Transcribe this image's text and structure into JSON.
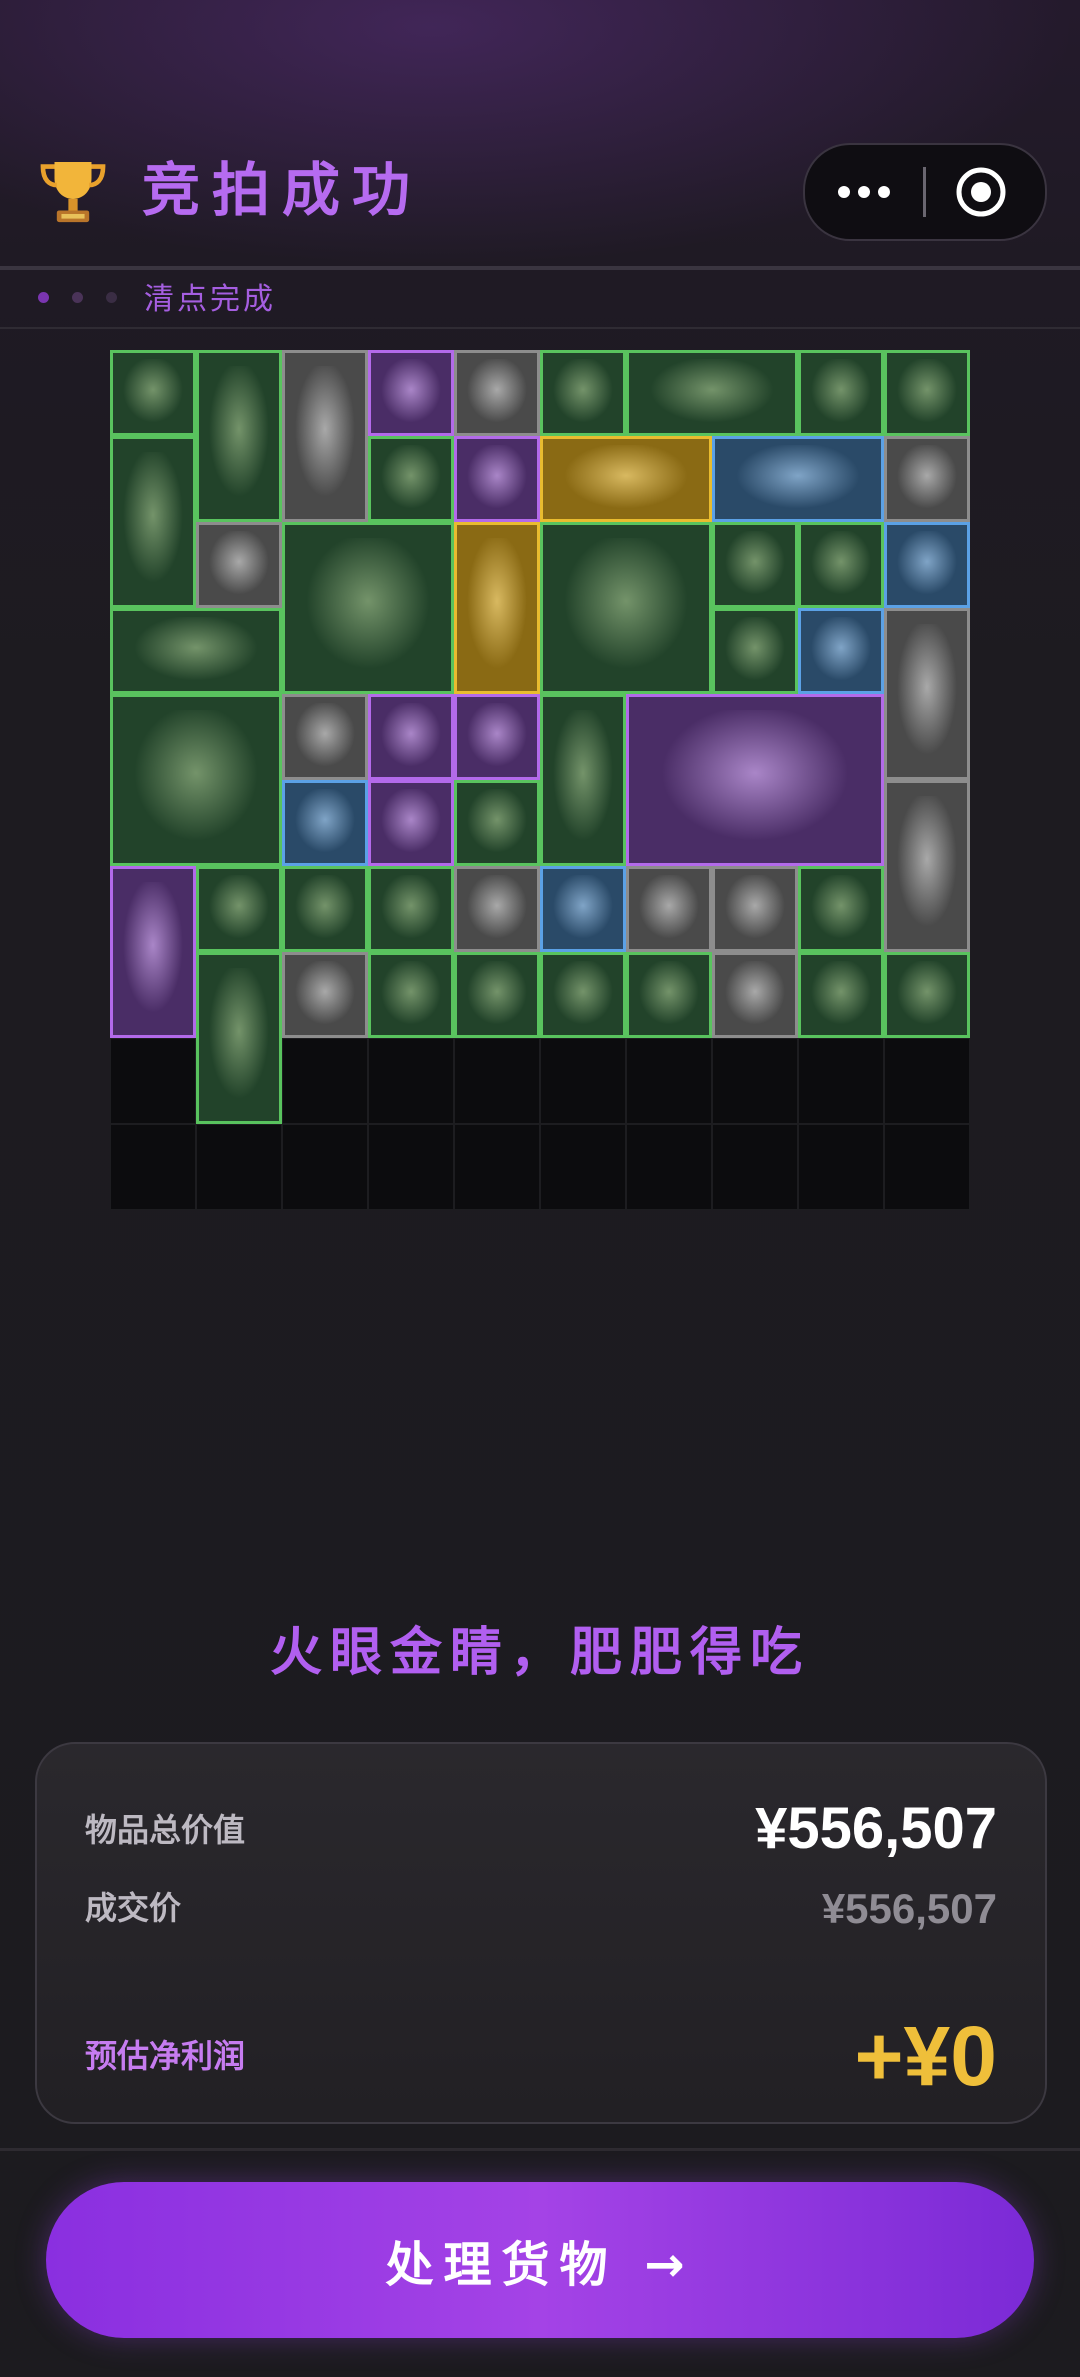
{
  "header": {
    "title": "竞拍成功",
    "trophy_icon": "trophy-icon",
    "capsule": {
      "more_icon": "more-dots-icon",
      "close_icon": "target-close-icon"
    }
  },
  "status": {
    "text": "清点完成",
    "dot_colors": [
      "#7a35b0",
      "#4a3358",
      "#3a2d44"
    ]
  },
  "inventory": {
    "columns": 10,
    "rows": 10,
    "rarity_colors": {
      "green": "#59c35e",
      "purple": "#b36aea",
      "blue": "#5ba1e6",
      "gold": "#e9bc2f",
      "gray": "#8d8d8d"
    },
    "items": [
      {
        "name": "tweezers",
        "rarity": "green",
        "c": 0,
        "r": 0,
        "w": 1,
        "h": 1
      },
      {
        "name": "leather-journal",
        "rarity": "green",
        "c": 1,
        "r": 0,
        "w": 1,
        "h": 2
      },
      {
        "name": "toothpaste",
        "rarity": "gray",
        "c": 2,
        "r": 0,
        "w": 1,
        "h": 2
      },
      {
        "name": "ring",
        "rarity": "purple",
        "c": 3,
        "r": 0,
        "w": 1,
        "h": 1
      },
      {
        "name": "yogurt-cup",
        "rarity": "gray",
        "c": 4,
        "r": 0,
        "w": 1,
        "h": 1
      },
      {
        "name": "pliers",
        "rarity": "green",
        "c": 5,
        "r": 0,
        "w": 1,
        "h": 1
      },
      {
        "name": "old-map",
        "rarity": "green",
        "c": 6,
        "r": 0,
        "w": 2,
        "h": 1
      },
      {
        "name": "power-strip",
        "rarity": "green",
        "c": 8,
        "r": 0,
        "w": 1,
        "h": 1
      },
      {
        "name": "coin",
        "rarity": "green",
        "c": 9,
        "r": 0,
        "w": 1,
        "h": 1
      },
      {
        "name": "spray-can",
        "rarity": "green",
        "c": 0,
        "r": 1,
        "w": 1,
        "h": 2
      },
      {
        "name": "screwdriver-pen",
        "rarity": "green",
        "c": 3,
        "r": 1,
        "w": 1,
        "h": 1
      },
      {
        "name": "knife",
        "rarity": "purple",
        "c": 4,
        "r": 1,
        "w": 1,
        "h": 1
      },
      {
        "name": "gold-tiara",
        "rarity": "gold",
        "c": 5,
        "r": 1,
        "w": 2,
        "h": 1
      },
      {
        "name": "smoking-pipe",
        "rarity": "blue",
        "c": 7,
        "r": 1,
        "w": 2,
        "h": 1
      },
      {
        "name": "gloves",
        "rarity": "gray",
        "c": 9,
        "r": 1,
        "w": 1,
        "h": 1
      },
      {
        "name": "playing-card",
        "rarity": "gray",
        "c": 1,
        "r": 2,
        "w": 1,
        "h": 1
      },
      {
        "name": "magazine",
        "rarity": "green",
        "c": 2,
        "r": 2,
        "w": 2,
        "h": 2
      },
      {
        "name": "test-tube-kit",
        "rarity": "gold",
        "c": 4,
        "r": 2,
        "w": 1,
        "h": 2
      },
      {
        "name": "angle-grinder",
        "rarity": "green",
        "c": 5,
        "r": 2,
        "w": 2,
        "h": 2
      },
      {
        "name": "tweezers",
        "rarity": "green",
        "c": 7,
        "r": 2,
        "w": 1,
        "h": 1
      },
      {
        "name": "wrench",
        "rarity": "green",
        "c": 8,
        "r": 2,
        "w": 1,
        "h": 1
      },
      {
        "name": "mp3-player",
        "rarity": "blue",
        "c": 9,
        "r": 2,
        "w": 1,
        "h": 1
      },
      {
        "name": "glass-tube",
        "rarity": "green",
        "c": 0,
        "r": 3,
        "w": 2,
        "h": 1
      },
      {
        "name": "screwdriver",
        "rarity": "green",
        "c": 7,
        "r": 3,
        "w": 1,
        "h": 1
      },
      {
        "name": "cd-disc",
        "rarity": "blue",
        "c": 8,
        "r": 3,
        "w": 1,
        "h": 1
      },
      {
        "name": "toothpaste",
        "rarity": "gray",
        "c": 9,
        "r": 3,
        "w": 1,
        "h": 2
      },
      {
        "name": "newspaper",
        "rarity": "green",
        "c": 0,
        "r": 4,
        "w": 2,
        "h": 2
      },
      {
        "name": "tape-measure",
        "rarity": "gray",
        "c": 2,
        "r": 4,
        "w": 1,
        "h": 1
      },
      {
        "name": "circuit-board",
        "rarity": "purple",
        "c": 3,
        "r": 4,
        "w": 1,
        "h": 1
      },
      {
        "name": "usb-stick",
        "rarity": "purple",
        "c": 4,
        "r": 4,
        "w": 1,
        "h": 1
      },
      {
        "name": "statue",
        "rarity": "green",
        "c": 5,
        "r": 4,
        "w": 1,
        "h": 2
      },
      {
        "name": "car-battery",
        "rarity": "purple",
        "c": 6,
        "r": 4,
        "w": 3,
        "h": 2
      },
      {
        "name": "power-bank",
        "rarity": "blue",
        "c": 2,
        "r": 5,
        "w": 1,
        "h": 1
      },
      {
        "name": "tea-cup",
        "rarity": "purple",
        "c": 3,
        "r": 5,
        "w": 1,
        "h": 1
      },
      {
        "name": "glue-bottle",
        "rarity": "green",
        "c": 4,
        "r": 5,
        "w": 1,
        "h": 1
      },
      {
        "name": "medicine-bottle",
        "rarity": "gray",
        "c": 9,
        "r": 5,
        "w": 1,
        "h": 2
      },
      {
        "name": "gold-ewer",
        "rarity": "purple",
        "c": 0,
        "r": 6,
        "w": 1,
        "h": 2
      },
      {
        "name": "battery",
        "rarity": "green",
        "c": 1,
        "r": 6,
        "w": 1,
        "h": 1
      },
      {
        "name": "apple",
        "rarity": "green",
        "c": 2,
        "r": 6,
        "w": 1,
        "h": 1
      },
      {
        "name": "card-pack",
        "rarity": "green",
        "c": 3,
        "r": 6,
        "w": 1,
        "h": 1
      },
      {
        "name": "duct-tape",
        "rarity": "gray",
        "c": 4,
        "r": 6,
        "w": 1,
        "h": 1
      },
      {
        "name": "capacitor",
        "rarity": "blue",
        "c": 5,
        "r": 6,
        "w": 1,
        "h": 1
      },
      {
        "name": "scissors",
        "rarity": "gray",
        "c": 6,
        "r": 6,
        "w": 1,
        "h": 1
      },
      {
        "name": "scissors",
        "rarity": "gray",
        "c": 7,
        "r": 6,
        "w": 1,
        "h": 1
      },
      {
        "name": "tweezers",
        "rarity": "green",
        "c": 8,
        "r": 6,
        "w": 1,
        "h": 1
      },
      {
        "name": "pressure-gauge",
        "rarity": "green",
        "c": 1,
        "r": 7,
        "w": 1,
        "h": 2
      },
      {
        "name": "papers",
        "rarity": "gray",
        "c": 2,
        "r": 7,
        "w": 1,
        "h": 1
      },
      {
        "name": "glue-bottle",
        "rarity": "green",
        "c": 3,
        "r": 7,
        "w": 1,
        "h": 1
      },
      {
        "name": "lighter",
        "rarity": "green",
        "c": 4,
        "r": 7,
        "w": 1,
        "h": 1
      },
      {
        "name": "hard-drive",
        "rarity": "green",
        "c": 5,
        "r": 7,
        "w": 1,
        "h": 1
      },
      {
        "name": "snack-bar",
        "rarity": "green",
        "c": 6,
        "r": 7,
        "w": 1,
        "h": 1
      },
      {
        "name": "pill-case",
        "rarity": "gray",
        "c": 7,
        "r": 7,
        "w": 1,
        "h": 1
      },
      {
        "name": "mouse-pad",
        "rarity": "green",
        "c": 8,
        "r": 7,
        "w": 1,
        "h": 1
      },
      {
        "name": "mouse-pad",
        "rarity": "green",
        "c": 9,
        "r": 7,
        "w": 1,
        "h": 1
      }
    ]
  },
  "slogan": "火眼金睛，肥肥得吃",
  "summary": {
    "total_label": "物品总价值",
    "total_value": "¥556,507",
    "deal_label": "成交价",
    "deal_value": "¥556,507",
    "profit_label": "预估净利润",
    "profit_value": "+¥0"
  },
  "cta": {
    "label": "处理货物 →"
  }
}
